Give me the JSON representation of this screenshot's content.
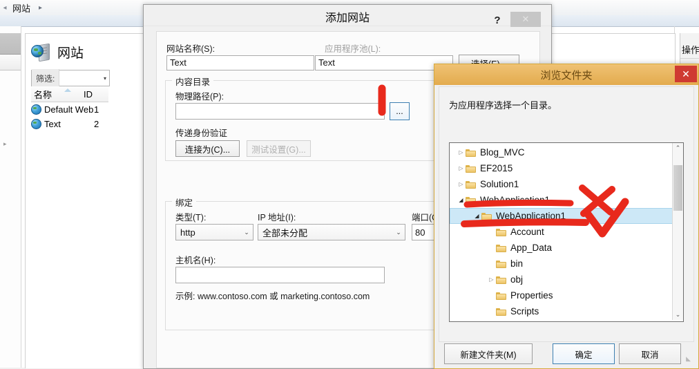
{
  "iis": {
    "breadcrumb": "网站",
    "breadcrumb_arrow": "▸",
    "page_title": "网站",
    "filter_label": "筛选:",
    "filter_value": "",
    "columns": [
      "名称",
      "ID"
    ],
    "rows": [
      {
        "name": "Default Web S...",
        "id": "1"
      },
      {
        "name": "Text",
        "id": "2"
      }
    ],
    "actions_title": "操作"
  },
  "add_site": {
    "title": "添加网站",
    "help_glyph": "?",
    "close_glyph": "✕",
    "site_name_label": "网站名称(S):",
    "site_name_value": "Text",
    "app_pool_label": "应用程序池(L):",
    "app_pool_value": "Text",
    "select_button": "选择(E)...",
    "content_dir_group": "内容目录",
    "physical_path_label": "物理路径(P):",
    "physical_path_value": "",
    "browse_button": "...",
    "passthrough_label": "传递身份验证",
    "connect_as_button": "连接为(C)...",
    "test_settings_button": "测试设置(G)...",
    "binding_group": "绑定",
    "type_label": "类型(T):",
    "type_value": "http",
    "ip_label": "IP 地址(I):",
    "ip_value": "全部未分配",
    "port_label": "端口(O",
    "port_value": "80",
    "hostname_label": "主机名(H):",
    "hostname_value": "",
    "example_text": "示例: www.contoso.com 或 marketing.contoso.com",
    "caret_glyph": "⌄"
  },
  "browse": {
    "title": "浏览文件夹",
    "close_glyph": "✕",
    "prompt": "为应用程序选择一个目录。",
    "tree": [
      {
        "label": "Blog_MVC",
        "indent": 0,
        "expander": "collapsed",
        "selected": false
      },
      {
        "label": "EF2015",
        "indent": 0,
        "expander": "collapsed",
        "selected": false
      },
      {
        "label": "Solution1",
        "indent": 0,
        "expander": "collapsed",
        "selected": false
      },
      {
        "label": "WebApplication1",
        "indent": 0,
        "expander": "expanded",
        "selected": false
      },
      {
        "label": "WebApplication1",
        "indent": 1,
        "expander": "expanded",
        "selected": true
      },
      {
        "label": "Account",
        "indent": 2,
        "expander": "none",
        "selected": false
      },
      {
        "label": "App_Data",
        "indent": 2,
        "expander": "none",
        "selected": false
      },
      {
        "label": "bin",
        "indent": 2,
        "expander": "none",
        "selected": false
      },
      {
        "label": "obj",
        "indent": 2,
        "expander": "collapsed",
        "selected": false
      },
      {
        "label": "Properties",
        "indent": 2,
        "expander": "none",
        "selected": false
      },
      {
        "label": "Scripts",
        "indent": 2,
        "expander": "none",
        "selected": false
      }
    ],
    "scroll_up_glyph": "⌃",
    "scroll_down_glyph": "⌄",
    "new_folder_button": "新建文件夹(M)",
    "ok_button": "确定",
    "cancel_button": "取消",
    "expander_collapsed_glyph": "▷",
    "expander_expanded_glyph": "◢"
  },
  "annotations": {
    "accent_color": "#e8291c",
    "marks": [
      "strike-through-line-upper",
      "strike-through-line-lower",
      "red-x-mark",
      "red-check-mark",
      "red-pointer-bar"
    ]
  }
}
